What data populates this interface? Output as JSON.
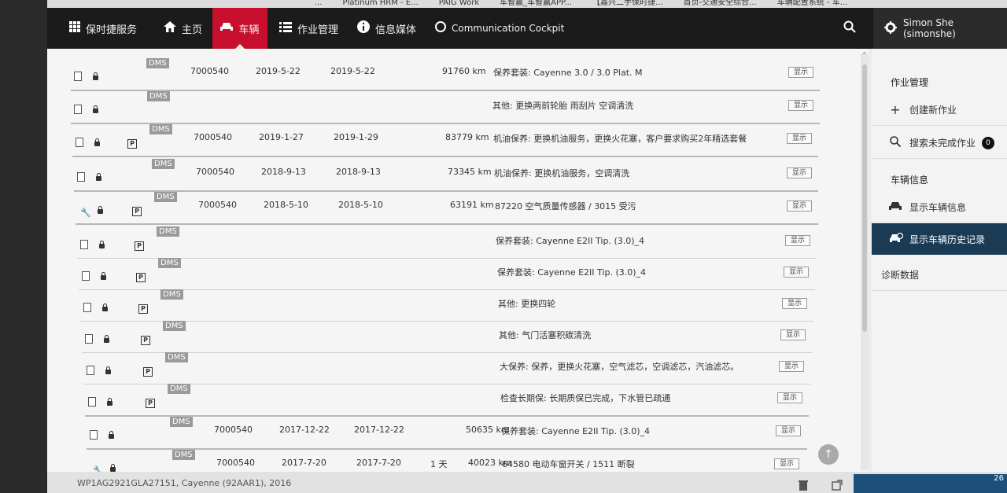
{
  "bookmarks": [
    "...",
    "Platinum HRM - E...",
    "PAIG Work",
    "车智赢_车智赢APP...",
    "【嘉兴二手保时捷...",
    "首页-交通安全综合...",
    "车辆配置系统 - 车..."
  ],
  "nav": {
    "porsche_service": "保时捷服务",
    "home": "主页",
    "vehicle": "车辆",
    "job_management": "作业管理",
    "info_media": "信息媒体",
    "communication_cockpit": "Communication Cockpit",
    "user": "Simon She (simonshe)"
  },
  "rows": [
    {
      "dms": "DMS",
      "order": "7000540",
      "date1": "2019-5-22",
      "date2": "2019-5-22",
      "days": "",
      "km": "91760 km",
      "desc": "保养套装: Cayenne 3.0 / 3.0 Plat. M",
      "show": "显示",
      "wrench": false,
      "p": false
    },
    {
      "dms": "DMS",
      "order": "",
      "date1": "",
      "date2": "",
      "days": "",
      "km": "",
      "desc": "其他: 更换两前轮胎 雨刮片 空调清洗",
      "show": "显示",
      "wrench": false,
      "p": false
    },
    {
      "dms": "DMS",
      "order": "7000540",
      "date1": "2019-1-27",
      "date2": "2019-1-29",
      "days": "",
      "km": "83779 km",
      "desc": "机油保养: 更换机油服务，更换火花塞，客户要求购买2年精选套餐",
      "show": "显示",
      "wrench": false,
      "p": true
    },
    {
      "dms": "DMS",
      "order": "7000540",
      "date1": "2018-9-13",
      "date2": "2018-9-13",
      "days": "",
      "km": "73345 km",
      "desc": "机油保养: 更换机油服务，空调清洗",
      "show": "显示",
      "wrench": false,
      "p": false
    },
    {
      "dms": "DMS",
      "order": "7000540",
      "date1": "2018-5-10",
      "date2": "2018-5-10",
      "days": "",
      "km": "63191 km",
      "desc": "87220 空气质量传感器 / 3015 受污",
      "show": "显示",
      "wrench": true,
      "p": true
    },
    {
      "dms": "DMS",
      "order": "",
      "date1": "",
      "date2": "",
      "days": "",
      "km": "",
      "desc": "保养套装: Cayenne E2II Tip. (3.0)_4",
      "show": "显示",
      "wrench": false,
      "p": true
    },
    {
      "dms": "DMS",
      "order": "",
      "date1": "",
      "date2": "",
      "days": "",
      "km": "",
      "desc": "保养套装: Cayenne E2II Tip. (3.0)_4",
      "show": "显示",
      "wrench": false,
      "p": true
    },
    {
      "dms": "DMS",
      "order": "",
      "date1": "",
      "date2": "",
      "days": "",
      "km": "",
      "desc": "其他: 更换四轮",
      "show": "显示",
      "wrench": false,
      "p": true
    },
    {
      "dms": "DMS",
      "order": "",
      "date1": "",
      "date2": "",
      "days": "",
      "km": "",
      "desc": "其他: 气门活塞积碳清洗",
      "show": "显示",
      "wrench": false,
      "p": true
    },
    {
      "dms": "DMS",
      "order": "",
      "date1": "",
      "date2": "",
      "days": "",
      "km": "",
      "desc": "大保养: 保养，更换火花塞，空气滤芯，空调滤芯，汽油滤芯。",
      "show": "显示",
      "wrench": false,
      "p": true
    },
    {
      "dms": "DMS",
      "order": "",
      "date1": "",
      "date2": "",
      "days": "",
      "km": "",
      "desc": "检查长期保: 长期质保已完成，下水管已疏通",
      "show": "显示",
      "wrench": false,
      "p": true
    },
    {
      "dms": "DMS",
      "order": "7000540",
      "date1": "2017-12-22",
      "date2": "2017-12-22",
      "days": "",
      "km": "50635 km",
      "desc": "保养套装: Cayenne E2II Tip. (3.0)_4",
      "show": "显示",
      "wrench": false,
      "p": false
    },
    {
      "dms": "DMS",
      "order": "7000540",
      "date1": "2017-7-20",
      "date2": "2017-7-20",
      "days": "1 天",
      "km": "40023 km",
      "desc": "64580 电动车窗开关 / 1511 断裂",
      "show": "显示",
      "wrench": true,
      "p": false
    }
  ],
  "footer": {
    "vehicle_info": "WP1AG2921GLA27151, Cayenne (92AAR1), 2016",
    "right": "26"
  },
  "panel": {
    "job_management": "作业管理",
    "create_job": "创建新作业",
    "search_incomplete": "搜索未完成作业",
    "incomplete_count": "0",
    "vehicle_info": "车辆信息",
    "show_vehicle_info": "显示车辆信息",
    "show_vehicle_history": "显示车辆历史记录",
    "diagnostic_data": "诊断数据"
  },
  "colors": {
    "nav_bg": "#1b1b1b",
    "active_red": "#c8102e",
    "panel_active": "#1b3b55"
  }
}
